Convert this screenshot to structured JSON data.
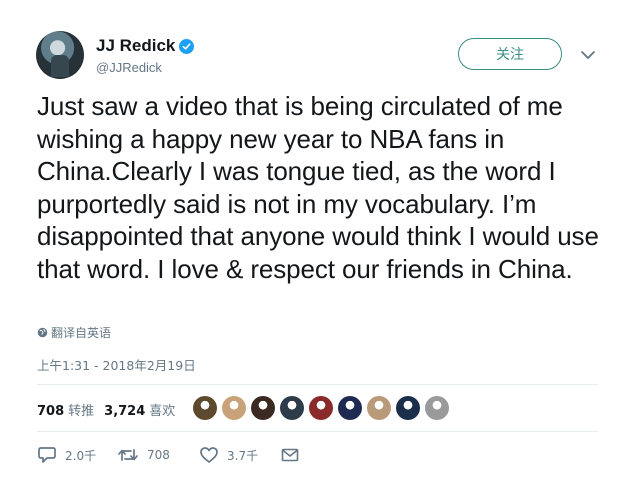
{
  "author": {
    "name": "JJ Redick",
    "handle": "@JJRedick",
    "verified": true
  },
  "follow_label": "关注",
  "tweet_text": "Just saw a video that is being circulated of me wishing a happy new year to NBA fans in China.Clearly I was tongue tied, as the word I purportedly said is not in my vocabulary. I’m disappointed that anyone would think I would use that word. I love & respect our friends in China.",
  "translate_label": "翻译自英语",
  "timestamp": "上午1:31 - 2018年2月19日",
  "stats": {
    "retweets_count": "708",
    "retweets_label": "转推",
    "likes_count": "3,724",
    "likes_label": "喜欢"
  },
  "liker_avatars": [
    {
      "color": "#5d4a2e"
    },
    {
      "color": "#c9a27a"
    },
    {
      "color": "#3b2a22"
    },
    {
      "color": "#2e3b4a"
    },
    {
      "color": "#8a2a2a"
    },
    {
      "color": "#1f2a52"
    },
    {
      "color": "#b89a7a"
    },
    {
      "color": "#1b2f4a"
    },
    {
      "color": "#9a9a9a"
    }
  ],
  "actions": {
    "reply_count": "2.0千",
    "retweet_count": "708",
    "like_count": "3.7千"
  },
  "colors": {
    "accent": "#1da1f2",
    "follow_border": "#3a8d85",
    "secondary_text": "#657786"
  }
}
